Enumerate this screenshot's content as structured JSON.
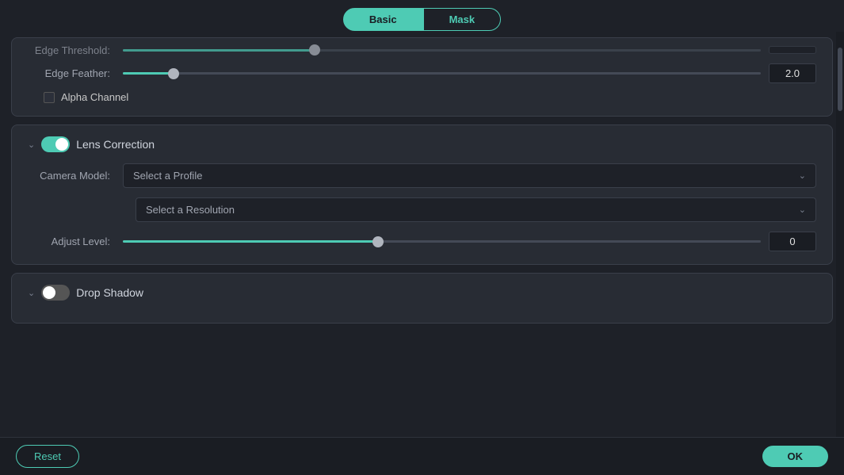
{
  "tabs": {
    "basic": "Basic",
    "mask": "Mask",
    "active": "basic"
  },
  "top_partial": {
    "edge_threshold_label": "Edge Threshold:",
    "edge_feather_label": "Edge Feather:",
    "edge_feather_value": "2.0",
    "edge_feather_thumb_pct": 8,
    "alpha_channel_label": "Alpha Channel"
  },
  "lens_correction": {
    "title": "Lens Correction",
    "camera_model_label": "Camera Model:",
    "camera_model_placeholder": "Select a Profile",
    "resolution_placeholder": "Select a Resolution",
    "adjust_level_label": "Adjust Level:",
    "adjust_level_value": "0",
    "adjust_level_thumb_pct": 40
  },
  "drop_shadow": {
    "title": "Drop Shadow"
  },
  "buttons": {
    "reset": "Reset",
    "ok": "OK"
  }
}
